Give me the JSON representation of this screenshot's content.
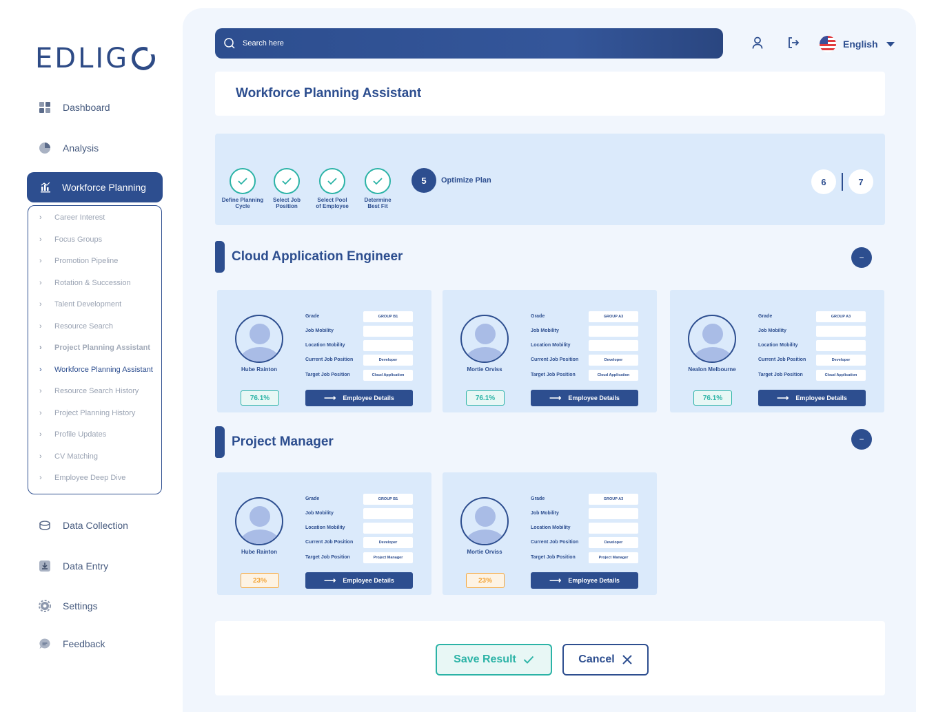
{
  "brand": {
    "logo_text": "EDLIG"
  },
  "sidebar": {
    "items": [
      {
        "label": "Dashboard",
        "icon": "grid-icon"
      },
      {
        "label": "Analysis",
        "icon": "pie-chart-icon"
      },
      {
        "label": "Workforce Planning",
        "icon": "bar-chart-icon"
      },
      {
        "label": "Data Collection",
        "icon": "database-icon"
      },
      {
        "label": "Data Entry",
        "icon": "download-icon"
      },
      {
        "label": "Settings",
        "icon": "gear-icon"
      },
      {
        "label": "Feedback",
        "icon": "chat-icon"
      }
    ],
    "submenu": [
      "Career Interest",
      "Focus Groups",
      "Promotion Pipeline",
      "Rotation & Succession",
      "Talent Development",
      "Resource Search",
      "Project Planning Assistant",
      "Workforce Planning Assistant",
      "Resource Search History",
      "Project Planning History",
      "Profile Updates",
      "CV Matching",
      "Employee Deep Dive"
    ]
  },
  "header": {
    "search_placeholder": "Search here",
    "language": "English"
  },
  "page_title": "Workforce Planning Assistant",
  "stepper": {
    "steps": [
      {
        "label_1": "Define Planning",
        "label_2": "Cycle"
      },
      {
        "label_1": "Select Job",
        "label_2": "Position"
      },
      {
        "label_1": "Select Pool",
        "label_2": "of Employee"
      },
      {
        "label_1": "Determine",
        "label_2": "Best Fit"
      }
    ],
    "current_number": "5",
    "current_label": "Optimize Plan",
    "next_pages": [
      "6",
      "7"
    ]
  },
  "attr_labels": [
    "Grade",
    "Job Mobility",
    "Location Mobility",
    "Current Job Position",
    "Target Job Position"
  ],
  "details_label": "Employee Details",
  "collapse_symbol": "−",
  "sections": [
    {
      "title": "Cloud Application Engineer",
      "employees": [
        {
          "name": "Hube Rainton",
          "grade": "GROUP B1",
          "job_mobility": "",
          "location_mobility": "",
          "current": "Developer",
          "target": "Cloud Application",
          "score": "76.1%"
        },
        {
          "name": "Mortie Orviss",
          "grade": "GROUP A3",
          "job_mobility": "",
          "location_mobility": "",
          "current": "Developer",
          "target": "Cloud Application",
          "score": "76.1%"
        },
        {
          "name": "Nealon Melbourne",
          "grade": "GROUP A3",
          "job_mobility": "",
          "location_mobility": "",
          "current": "Developer",
          "target": "Cloud Application",
          "score": "76.1%"
        }
      ]
    },
    {
      "title": "Project Manager",
      "employees": [
        {
          "name": "Hube Rainton",
          "grade": "GROUP B1",
          "job_mobility": "",
          "location_mobility": "",
          "current": "Developer",
          "target": "Project Manager",
          "score": "23%"
        },
        {
          "name": "Mortie Orviss",
          "grade": "GROUP A3",
          "job_mobility": "",
          "location_mobility": "",
          "current": "Developer",
          "target": "Project Manager",
          "score": "23%"
        }
      ]
    }
  ],
  "actions": {
    "save": "Save Result",
    "cancel": "Cancel"
  },
  "colors": {
    "primary": "#2d4e8f",
    "accent": "#2bb3a6",
    "warning": "#f2a53a",
    "panel": "#dbeafb",
    "background": "#f1f6fd"
  }
}
